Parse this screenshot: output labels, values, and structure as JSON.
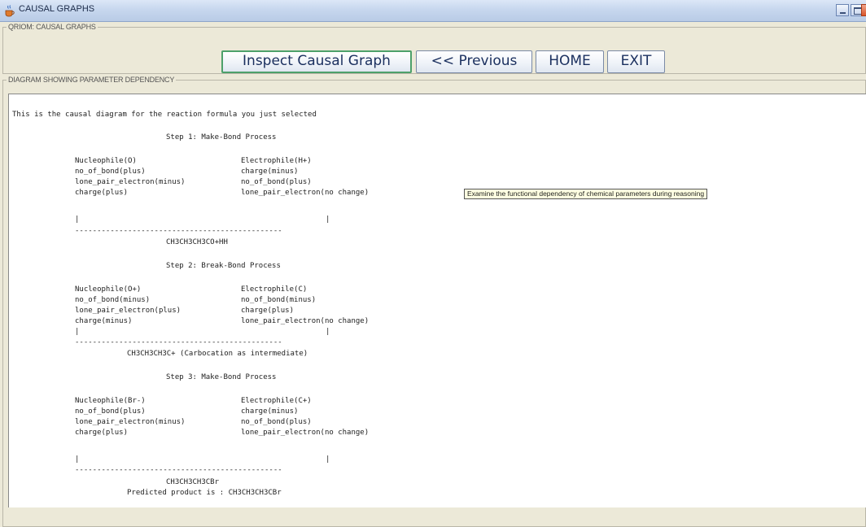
{
  "window": {
    "title": "CAUSAL GRAPHS",
    "app_icon": "java-cup-icon"
  },
  "top_group": {
    "legend": "QRIOM: CAUSAL GRAPHS"
  },
  "toolbar": {
    "inspect_label": "Inspect Causal Graph",
    "previous_label": "<< Previous",
    "home_label": "HOME",
    "exit_label": "EXIT"
  },
  "diagram_group": {
    "legend": "DIAGRAM SHOWING PARAMETER DEPENDENCY"
  },
  "diagram": {
    "intro": "This is the causal diagram for the reaction formula you just selected",
    "step1": {
      "title": "Step 1: Make-Bond Process",
      "left": [
        "Nucleophile(O)",
        "no_of_bond(plus)",
        "lone_pair_electron(minus)",
        "charge(plus)"
      ],
      "right": [
        "Electrophile(H+)",
        "charge(minus)",
        "no_of_bond(plus)",
        "lone_pair_electron(no change)"
      ],
      "product": "CH3CH3CH3CO+HH"
    },
    "step2": {
      "title": "Step 2: Break-Bond Process",
      "left": [
        "Nucleophile(O+)",
        "no_of_bond(minus)",
        "lone_pair_electron(plus)",
        "charge(minus)"
      ],
      "right": [
        "Electrophile(C)",
        "no_of_bond(minus)",
        "charge(plus)",
        "lone_pair_electron(no change)"
      ],
      "product": "CH3CH3CH3C+ (Carbocation as intermediate)"
    },
    "step3": {
      "title": "Step 3: Make-Bond Process",
      "left": [
        "Nucleophile(Br-)",
        "no_of_bond(plus)",
        "lone_pair_electron(minus)",
        "charge(plus)"
      ],
      "right": [
        "Electrophile(C+)",
        "charge(minus)",
        "no_of_bond(plus)",
        "lone_pair_electron(no change)"
      ],
      "product": "CH3CH3CH3CBr"
    },
    "bar_glyph": "|",
    "divider": "-----------------------------------------------",
    "prediction": "Predicted product is : CH3CH3CH3CBr"
  },
  "tooltip": "Examine the functional dependency of chemical parameters during reasoning"
}
